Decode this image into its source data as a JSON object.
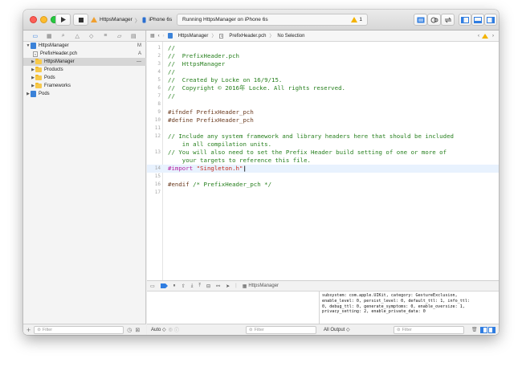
{
  "toolbar": {
    "scheme_name": "HttpsManager",
    "device_name": "iPhone 6s",
    "activity_text": "Running HttpsManager on iPhone 6s",
    "warning_count": "1",
    "colors": {
      "close": "#fc5f57",
      "minimize": "#fdbc2e",
      "zoom": "#28c840",
      "accent": "#3b82d8"
    }
  },
  "navigator": {
    "items": [
      {
        "label": "HttpsManager",
        "flag": "M"
      },
      {
        "label": "PrefixHeader.pch",
        "flag": "A"
      },
      {
        "label": "HttpsManager",
        "flag": "—"
      },
      {
        "label": "Products"
      },
      {
        "label": "Pods"
      },
      {
        "label": "Frameworks"
      },
      {
        "label": "Pods"
      }
    ],
    "filter_placeholder": "Filter"
  },
  "jumpbar": {
    "project": "HttpsManager",
    "file": "PrefixHeader.pch",
    "selection": "No Selection"
  },
  "editor": {
    "line_numbers": [
      "1",
      "2",
      "3",
      "4",
      "5",
      "6",
      "7",
      "8",
      "9",
      "10",
      "11",
      "12",
      "",
      "13",
      "",
      "14",
      "15",
      "16",
      "17"
    ],
    "lines": [
      "//",
      "//  PrefixHeader.pch",
      "//  HttpsManager",
      "//",
      "//  Created by Locke on 16/9/15.",
      "//  Copyright © 2016年 Locke. All rights reserved.",
      "//",
      "",
      "#ifndef PrefixHeader_pch",
      "#define PrefixHeader_pch",
      "",
      "// Include any system framework and library headers here that should be included",
      "    in all compilation units.",
      "// You will also need to set the Prefix Header build setting of one or more of",
      "    your targets to reference this file.",
      "#import \"Singleton.h\"",
      "",
      "#endif /* PrefixHeader_pch */",
      ""
    ],
    "import_kw": "#import",
    "import_str": "\"Singleton.h\""
  },
  "debug": {
    "target_label": "HttpsManager",
    "console_text": "subsystem: com.apple.UIKit, category: GestureExclusion,\nenable_level: 0, persist_level: 0, default_ttl: 1, info_ttl:\n0, debug_ttl: 0, generate_symptoms: 0, enable_oversize: 1,\nprivacy_setting: 2, enable_private_data: 0",
    "auto_label": "Auto ◇",
    "filter_placeholder": "Filter",
    "output_label": "All Output ◇"
  }
}
